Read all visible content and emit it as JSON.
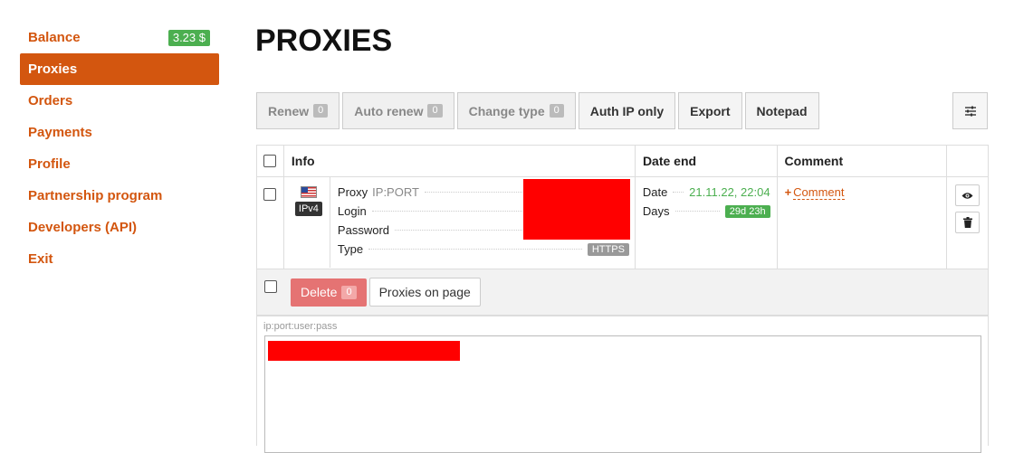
{
  "sidebar": {
    "balance_label": "Balance",
    "balance_value": "3.23 $",
    "items": [
      {
        "label": "Proxies"
      },
      {
        "label": "Orders"
      },
      {
        "label": "Payments"
      },
      {
        "label": "Profile"
      },
      {
        "label": "Partnership program"
      },
      {
        "label": "Developers (API)"
      },
      {
        "label": "Exit"
      }
    ]
  },
  "page_title": "PROXIES",
  "toolbar": {
    "renew_label": "Renew",
    "renew_count": "0",
    "auto_renew_label": "Auto renew",
    "auto_renew_count": "0",
    "change_type_label": "Change type",
    "change_type_count": "0",
    "auth_ip_label": "Auth IP only",
    "export_label": "Export",
    "notepad_label": "Notepad",
    "settings_icon": "sliders-icon"
  },
  "table": {
    "headers": {
      "info": "Info",
      "date_end": "Date end",
      "comment": "Comment"
    },
    "row": {
      "flag_icon": "us-flag-icon",
      "ip_version": "IPv4",
      "proxy_label": "Proxy",
      "proxy_value": "IP:PORT",
      "login_label": "Login",
      "password_label": "Password",
      "type_label": "Type",
      "type_value": "HTTPS",
      "date_label": "Date",
      "date_value": "21.11.22, 22:04",
      "days_label": "Days",
      "days_value": "29d 23h",
      "comment_link": "Comment"
    },
    "footer": {
      "delete_label": "Delete",
      "delete_count": "0",
      "proxies_on_page_label": "Proxies on page"
    }
  },
  "export": {
    "format_label": "ip:port:user:pass"
  },
  "colors": {
    "accent": "#d3560f",
    "success": "#4caf50",
    "danger": "#e57373",
    "redacted": "#ff0000"
  }
}
